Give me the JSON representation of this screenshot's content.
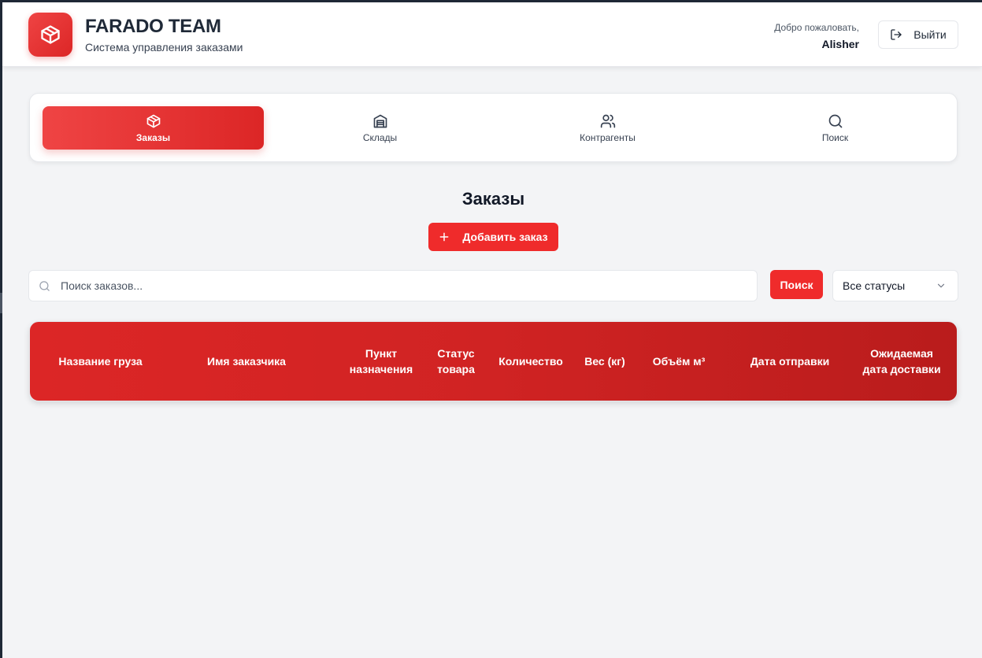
{
  "header": {
    "brand_title": "FARADO TEAM",
    "brand_subtitle": "Система управления заказами",
    "welcome_label": "Добро пожаловать,",
    "username": "Alisher",
    "logout_label": "Выйти"
  },
  "nav": {
    "tabs": [
      {
        "label": "Заказы",
        "icon": "box-icon",
        "active": true
      },
      {
        "label": "Склады",
        "icon": "warehouse-icon",
        "active": false
      },
      {
        "label": "Контрагенты",
        "icon": "users-icon",
        "active": false
      },
      {
        "label": "Поиск",
        "icon": "search-icon",
        "active": false
      }
    ]
  },
  "main": {
    "title": "Заказы",
    "add_button_label": "Добавить заказ",
    "search_placeholder": "Поиск заказов...",
    "search_button_label": "Поиск",
    "status_filter_value": "Все статусы"
  },
  "table": {
    "columns": [
      "Название груза",
      "Имя заказчика",
      "Пункт назначения",
      "Статус товара",
      "Количество",
      "Вес (кг)",
      "Объём м³",
      "Дата отправки",
      "Ожидаемая дата доставки"
    ],
    "rows": []
  },
  "colors": {
    "accent": "#ef2b2b",
    "accent_dark": "#b91c1c",
    "background": "#f3f4f6"
  }
}
